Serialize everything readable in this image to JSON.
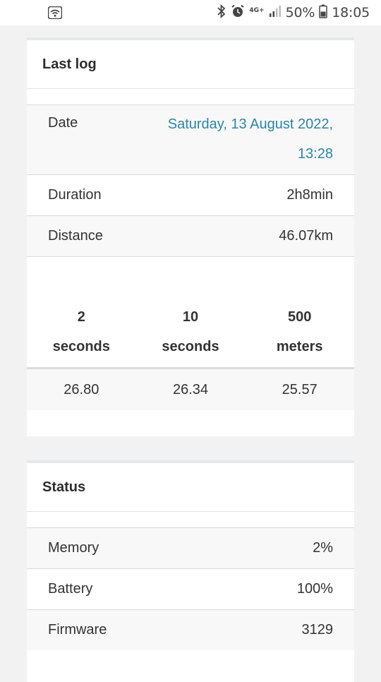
{
  "status_bar": {
    "battery_percent": "50%",
    "time": "18:05",
    "network": "4G+",
    "icons": [
      "wifi-icon",
      "bluetooth-icon",
      "alarm-icon",
      "network-4g-icon",
      "signal-icon",
      "battery-icon"
    ]
  },
  "last_log": {
    "title": "Last log",
    "date_label": "Date",
    "date_value_line1": "Saturday, 13 August 2022,",
    "date_value_line2": "13:28",
    "duration_label": "Duration",
    "duration_value": "2h8min",
    "distance_label": "Distance",
    "distance_value": "46.07km",
    "metrics": [
      {
        "header_line1": "2",
        "header_line2": "seconds",
        "value": "26.80"
      },
      {
        "header_line1": "10",
        "header_line2": "seconds",
        "value": "26.34"
      },
      {
        "header_line1": "500",
        "header_line2": "meters",
        "value": "25.57"
      }
    ]
  },
  "status": {
    "title": "Status",
    "rows": [
      {
        "label": "Memory",
        "value": "2%"
      },
      {
        "label": "Battery",
        "value": "100%"
      },
      {
        "label": "Firmware",
        "value": "3129"
      }
    ]
  },
  "colors": {
    "accent_link": "#2a86a6",
    "background": "#f2f2f2",
    "card": "#ffffff"
  }
}
